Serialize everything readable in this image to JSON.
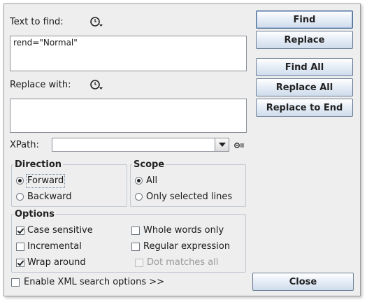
{
  "find": {
    "label": "Text to find:",
    "value": "rend=\"Normal\"",
    "history_icon": "history-dropdown-icon"
  },
  "replace": {
    "label": "Replace with:",
    "value": "",
    "history_icon": "history-dropdown-icon"
  },
  "xpath": {
    "label": "XPath:",
    "value": "",
    "settings_icon": "gear-settings-icon"
  },
  "direction": {
    "title": "Direction",
    "options": [
      {
        "label": "Forward",
        "selected": true
      },
      {
        "label": "Backward",
        "selected": false
      }
    ]
  },
  "scope": {
    "title": "Scope",
    "options": [
      {
        "label": "All",
        "selected": true
      },
      {
        "label": "Only selected lines",
        "selected": false
      }
    ]
  },
  "options": {
    "title": "Options",
    "items": [
      {
        "label": "Case sensitive",
        "checked": true,
        "enabled": true
      },
      {
        "label": "Whole words only",
        "checked": false,
        "enabled": true
      },
      {
        "label": "Incremental",
        "checked": false,
        "enabled": true
      },
      {
        "label": "Regular expression",
        "checked": false,
        "enabled": true
      },
      {
        "label": "Wrap around",
        "checked": true,
        "enabled": true
      },
      {
        "label": "Dot matches all",
        "checked": false,
        "enabled": false
      }
    ]
  },
  "xml_options": {
    "label": "Enable XML search options >>",
    "checked": false
  },
  "buttons": {
    "find": "Find",
    "replace": "Replace",
    "find_all": "Find All",
    "replace_all": "Replace All",
    "replace_to_end": "Replace to End",
    "close": "Close"
  }
}
